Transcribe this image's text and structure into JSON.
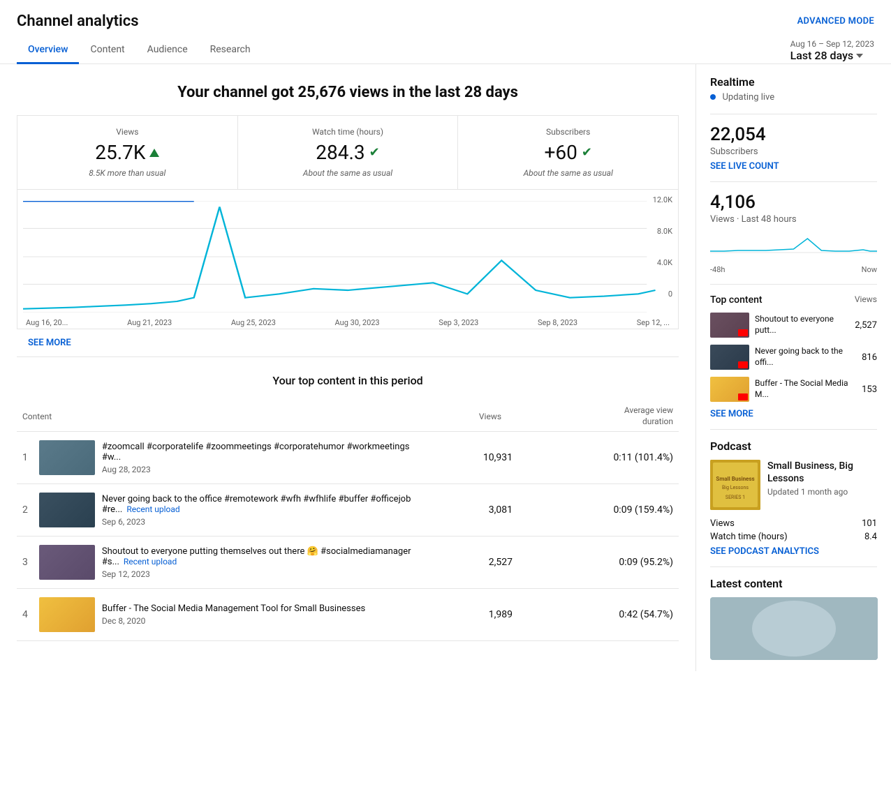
{
  "header": {
    "title": "Channel analytics",
    "advanced_mode_label": "ADVANCED MODE"
  },
  "date_selector": {
    "range_label": "Aug 16 – Sep 12, 2023",
    "period_label": "Last 28 days"
  },
  "nav": {
    "tabs": [
      "Overview",
      "Content",
      "Audience",
      "Research"
    ],
    "active": 0
  },
  "chart": {
    "heading": "Your channel got 25,676 views in the last 28 days",
    "metrics": [
      {
        "label": "Views",
        "value": "25.7K",
        "indicator": "arrow-up",
        "sub": "8.5K more than usual"
      },
      {
        "label": "Watch time (hours)",
        "value": "284.3",
        "indicator": "check",
        "sub": "About the same as usual"
      },
      {
        "label": "Subscribers",
        "value": "+60",
        "indicator": "check",
        "sub": "About the same as usual"
      }
    ],
    "x_labels": [
      "Aug 16, 20...",
      "Aug 21, 2023",
      "Aug 25, 2023",
      "Aug 30, 2023",
      "Sep 3, 2023",
      "Sep 8, 2023",
      "Sep 12, ..."
    ],
    "y_labels": [
      "12.0K",
      "8.0K",
      "4.0K",
      "0"
    ],
    "see_more": "SEE MORE"
  },
  "top_content": {
    "heading": "Your top content in this period",
    "columns": {
      "content": "Content",
      "views": "Views",
      "avg_duration": "Average view\nduration"
    },
    "rows": [
      {
        "rank": 1,
        "title": "#zoomcall #corporatelife #zoommeetings #corporatehumor #workmeetings #w...",
        "date": "Aug 28, 2023",
        "recent": false,
        "views": "10,931",
        "duration": "0:11",
        "pct": "(101.4%)",
        "thumb_class": "thumb-1"
      },
      {
        "rank": 2,
        "title": "Never going back to the office #remotework #wfh #wfhlife #buffer #officejob #re...",
        "date": "Sep 6, 2023",
        "recent": true,
        "views": "3,081",
        "duration": "0:09",
        "pct": "(159.4%)",
        "thumb_class": "thumb-2"
      },
      {
        "rank": 3,
        "title": "Shoutout to everyone putting themselves out there 🤗 #socialmediamanager #s...",
        "date": "Sep 12, 2023",
        "recent": true,
        "views": "2,527",
        "duration": "0:09",
        "pct": "(95.2%)",
        "thumb_class": "thumb-3"
      },
      {
        "rank": 4,
        "title": "Buffer - The Social Media Management Tool for Small Businesses",
        "date": "Dec 8, 2020",
        "recent": false,
        "views": "1,989",
        "duration": "0:42",
        "pct": "(54.7%)",
        "thumb_class": "thumb-4"
      }
    ],
    "recent_label": "Recent upload"
  },
  "realtime": {
    "title": "Realtime",
    "live_label": "Updating live",
    "subscribers": "22,054",
    "subscribers_label": "Subscribers",
    "see_live_count": "SEE LIVE COUNT",
    "views_count": "4,106",
    "views_label": "Views · Last 48 hours",
    "chart_labels": [
      "-48h",
      "Now"
    ],
    "top_content_label": "Top content",
    "views_col": "Views",
    "top_items": [
      {
        "title": "Shoutout to everyone putt...",
        "views": "2,527",
        "thumb_class": "top-thumb-1"
      },
      {
        "title": "Never going back to the offi...",
        "views": "816",
        "thumb_class": "top-thumb-2"
      },
      {
        "title": "Buffer - The Social Media M...",
        "views": "153",
        "thumb_class": "top-thumb-3"
      }
    ],
    "see_more": "SEE MORE"
  },
  "podcast": {
    "title": "Podcast",
    "name": "Small Business, Big Lessons",
    "updated": "Updated 1 month ago",
    "stats": [
      {
        "label": "Views",
        "value": "101"
      },
      {
        "label": "Watch time (hours)",
        "value": "8.4"
      }
    ],
    "see_analytics": "SEE PODCAST ANALYTICS"
  },
  "latest_content": {
    "title": "Latest content"
  }
}
